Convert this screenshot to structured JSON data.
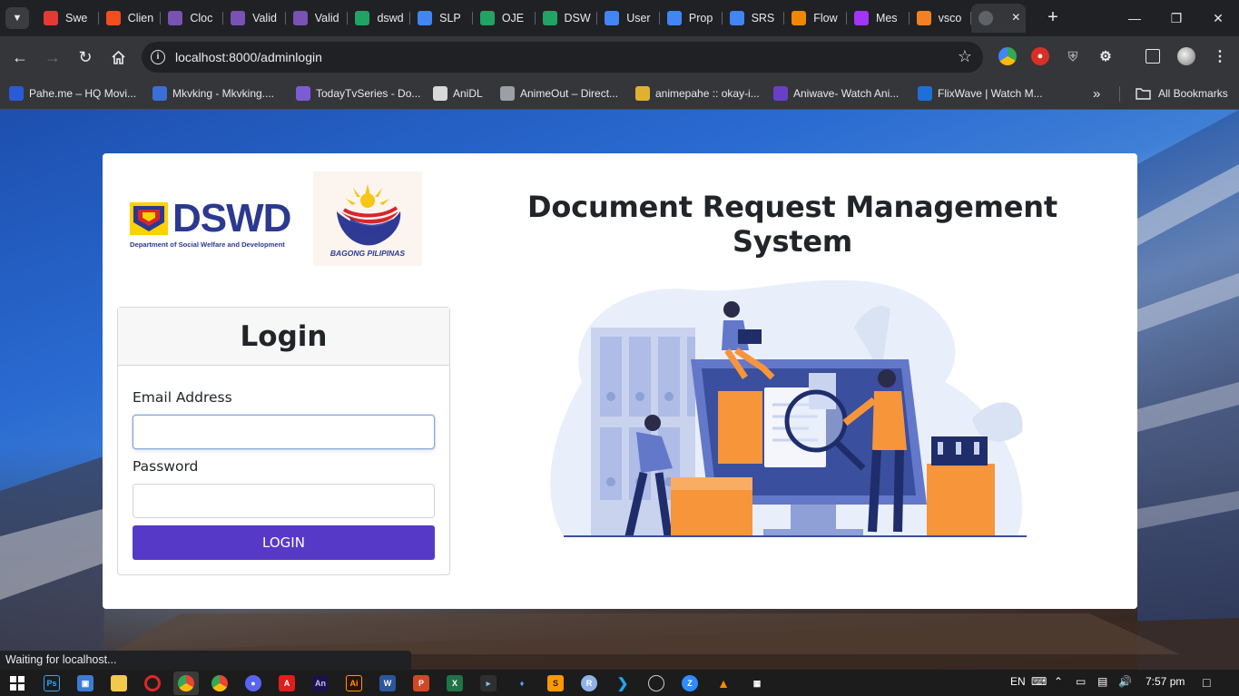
{
  "browser": {
    "tabs": [
      {
        "title": "Swe",
        "icon": "swe-icon",
        "color": "#e53935"
      },
      {
        "title": "Clien",
        "icon": "figma-icon",
        "color": "#f24e1e"
      },
      {
        "title": "Cloc",
        "icon": "bootstrap-icon",
        "color": "#7952b3"
      },
      {
        "title": "Valid",
        "icon": "bootstrap-icon",
        "color": "#7952b3"
      },
      {
        "title": "Valid",
        "icon": "bootstrap-icon",
        "color": "#7952b3"
      },
      {
        "title": "dswd",
        "icon": "google-drive-icon",
        "color": "#1fa463"
      },
      {
        "title": "SLP",
        "icon": "google-docs-icon",
        "color": "#4285f4"
      },
      {
        "title": "OJE",
        "icon": "google-drive-icon",
        "color": "#1fa463"
      },
      {
        "title": "DSW",
        "icon": "google-drive-icon",
        "color": "#1fa463"
      },
      {
        "title": "User",
        "icon": "google-docs-icon",
        "color": "#4285f4"
      },
      {
        "title": "Prop",
        "icon": "google-docs-icon",
        "color": "#4285f4"
      },
      {
        "title": "SRS",
        "icon": "google-docs-icon",
        "color": "#4285f4"
      },
      {
        "title": "Flow",
        "icon": "drawio-icon",
        "color": "#f08705"
      },
      {
        "title": "Mes",
        "icon": "messenger-icon",
        "color": "#a334fa"
      },
      {
        "title": "vsco",
        "icon": "stackoverflow-icon",
        "color": "#f48024"
      }
    ],
    "url": "localhost:8000/adminlogin",
    "bookmarks": [
      {
        "label": "Pahe.me – HQ Movi...",
        "icon": "pahe-icon",
        "color": "#2a5bd7"
      },
      {
        "label": "Mkvking - Mkvking....",
        "icon": "mkvking-icon",
        "color": "#3b6fd8"
      },
      {
        "label": "TodayTvSeries - Do...",
        "icon": "todaytv-icon",
        "color": "#7b5cd6"
      },
      {
        "label": "AniDL",
        "icon": "anidl-icon",
        "color": "#d9d9d9"
      },
      {
        "label": "AnimeOut – Direct...",
        "icon": "globe-icon",
        "color": "#9aa0a6"
      },
      {
        "label": "animepahe :: okay-i...",
        "icon": "animepahe-icon",
        "color": "#e0b030"
      },
      {
        "label": "Aniwave- Watch Ani...",
        "icon": "aniwave-icon",
        "color": "#6a3fc8"
      },
      {
        "label": "FlixWave | Watch M...",
        "icon": "flixwave-icon",
        "color": "#1e6fd9"
      }
    ],
    "all_bookmarks_label": "All Bookmarks",
    "status_text": "Waiting for localhost..."
  },
  "page": {
    "dswd_acronym": "DSWD",
    "dswd_fullname": "Department of Social Welfare and Development",
    "bagong_pilipinas": "BAGONG PILIPINAS",
    "system_title": "Document Request Management System",
    "login": {
      "heading": "Login",
      "email_label": "Email Address",
      "email_value": "",
      "password_label": "Password",
      "password_value": "",
      "button_label": "LOGIN"
    }
  },
  "taskbar": {
    "language": "EN",
    "time": "7:57 pm"
  },
  "colors": {
    "login_button": "#5639c6",
    "dswd_blue": "#2b3990",
    "dswd_red": "#d7262c",
    "dswd_yellow": "#fcd200",
    "illustration_orange": "#f7953b",
    "illustration_blue": "#3a4f9e"
  }
}
